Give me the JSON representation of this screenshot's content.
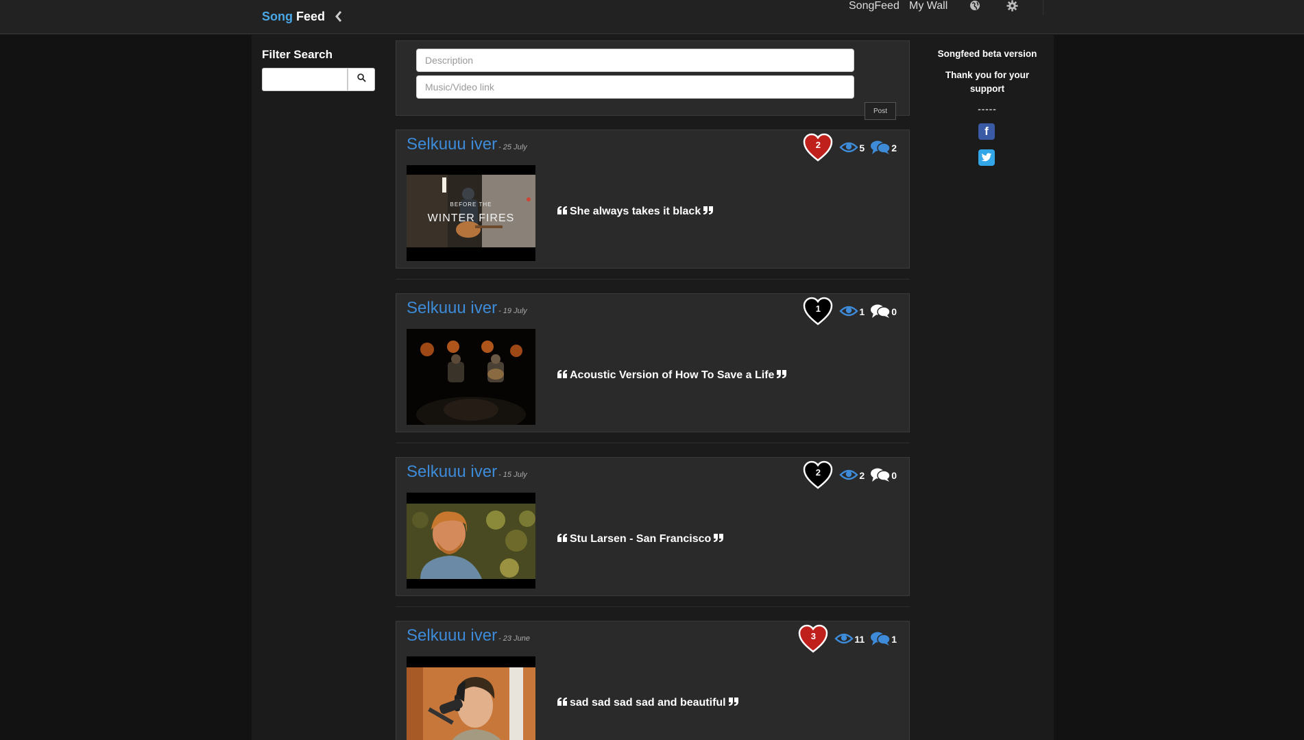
{
  "navbar": {
    "brand_part1": "Song",
    "brand_part2": "Feed",
    "links": [
      "SongFeed",
      "My Wall"
    ],
    "icons": [
      "chevron-left-icon",
      "globe-icon",
      "gear-icon"
    ]
  },
  "sidebar": {
    "filter_title": "Filter Search",
    "search_value": ""
  },
  "post_form": {
    "description_placeholder": "Description",
    "link_placeholder": "Music/Video link",
    "post_label": "Post"
  },
  "right": {
    "beta": "Songfeed beta version",
    "thanks": "Thank you for your support",
    "dashes": "-----",
    "social_icons": [
      "facebook-icon",
      "twitter-icon"
    ]
  },
  "colors": {
    "accent": "#3d8bd9",
    "brand_blue": "#4aa7e6",
    "liked_heart": "#c0201c"
  },
  "posts": [
    {
      "author": "Selkuuu iver",
      "date": "- 25 July",
      "likes": "2",
      "liked": true,
      "views": "5",
      "comments": "2",
      "commented": true,
      "quote": "She always takes it black"
    },
    {
      "author": "Selkuuu iver",
      "date": "- 19 July",
      "likes": "1",
      "liked": false,
      "views": "1",
      "comments": "0",
      "commented": false,
      "quote": "Acoustic Version of How To Save a Life"
    },
    {
      "author": "Selkuuu iver",
      "date": "- 15 July",
      "likes": "2",
      "liked": false,
      "views": "2",
      "comments": "0",
      "commented": false,
      "quote": "Stu Larsen - San Francisco"
    },
    {
      "author": "Selkuuu iver",
      "date": "- 23 June",
      "likes": "3",
      "liked": true,
      "views": "11",
      "comments": "1",
      "commented": true,
      "quote": "sad sad sad sad and beautiful"
    }
  ],
  "thumb1_text": {
    "line1": "BEFORE THE",
    "line2": "WINTER FIRES"
  }
}
